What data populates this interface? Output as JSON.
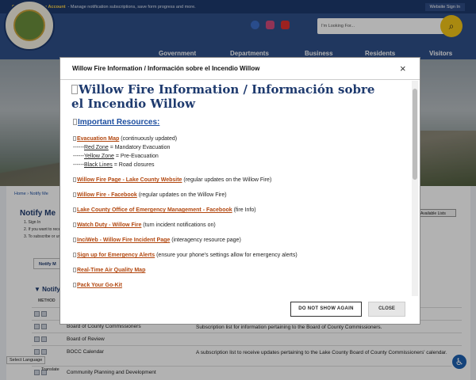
{
  "topbar": {
    "create_link": "Create a Website Account",
    "create_desc": "- Manage notification subscriptions, save form progress and more.",
    "signin": "Website Sign In"
  },
  "header": {
    "search_placeholder": "I'm Looking For...",
    "nav": [
      "Government",
      "Departments",
      "Business",
      "Residents",
      "Visitors"
    ]
  },
  "page": {
    "breadcrumb": "Home › Notify Me",
    "title": "Notify Me",
    "steps": [
      "1. Sign In",
      "2. If you want to rece",
      "3. To subscribe or ur"
    ],
    "available_lists": "Available Lists",
    "notify_tab": "Notify M",
    "notify_heading": "▼ Notify",
    "method_label": "METHOD",
    "rows": [
      {
        "name": "",
        "desc": ""
      },
      {
        "name": "Board of County Commissioners",
        "desc": "Subscription list for information pertaining to the Board of County Commissioners."
      },
      {
        "name": "Board of Review",
        "desc": ""
      },
      {
        "name": "BOCC Calendar",
        "desc": "A subscription list to receive updates pertaining to the Lake County Board of County Commissioners' calendar."
      },
      {
        "name": "Community Planning and Development",
        "desc": ""
      }
    ],
    "translate_label": "Select Language",
    "translate_link": "Translate"
  },
  "modal": {
    "title": "Willow Fire Information / Información sobre el Incendio Willow",
    "heading": "Willow Fire Information / Información sobre el Incendio Willow",
    "resources_heading": "Important Resources:",
    "evac_map": "Evacuation Map",
    "evac_map_note": " (continuously updated)",
    "zones": [
      {
        "prefix": "------",
        "zone": "Red Zone",
        "desc": " = Mandatory Evacuation"
      },
      {
        "prefix": "------",
        "zone": "Yellow Zone",
        "desc": " = Pre-Evacuation"
      },
      {
        "prefix": "------",
        "zone": "Black Lines",
        "desc": " = Road closures"
      }
    ],
    "links": [
      {
        "text": "Willow Fire Page - Lake County Website",
        "note": " (regular updates on the Willow Fire)"
      },
      {
        "text": "Willow Fire - Facebook",
        "note": " (regular updates on the Willow Fire)"
      },
      {
        "text": "Lake County Office of Emergency Management - Facebook",
        "note": " (fire Info)"
      },
      {
        "text": "Watch Duty - Willow Fire",
        "note": " (turn incident notifications on)"
      },
      {
        "text": "InciWeb - Willow Fire Incident Page",
        "note": " (interagency resource page)"
      },
      {
        "text": "Sign up for Emergency Alerts",
        "note": " (ensure your phone's settings allow for emergency alerts)"
      },
      {
        "text": "Real-Time Air Quality Map",
        "note": ""
      },
      {
        "text": "Pack Your Go-Kit",
        "note": ""
      }
    ],
    "btn_dont_show": "DO NOT SHOW AGAIN",
    "btn_close": "CLOSE",
    "close_glyph": "×"
  },
  "colors": {
    "brand_navy": "#1e3a6e",
    "link_orange": "#b2470f",
    "search_yellow": "#f2c418"
  }
}
